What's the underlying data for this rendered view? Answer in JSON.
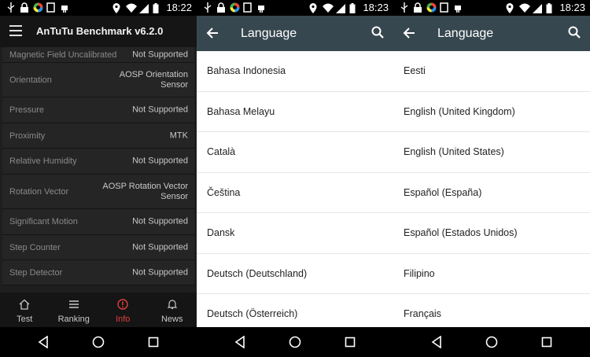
{
  "status": {
    "times": [
      "18:22",
      "18:23",
      "18:23"
    ]
  },
  "antutu": {
    "title": "AnTuTu Benchmark v6.2.0",
    "sensors": [
      {
        "name": "Magnetic Field Uncalibrated",
        "value": "Not Supported"
      },
      {
        "name": "Orientation",
        "value": "AOSP Orientation\nSensor"
      },
      {
        "name": "Pressure",
        "value": "Not Supported"
      },
      {
        "name": "Proximity",
        "value": "MTK"
      },
      {
        "name": "Relative Humidity",
        "value": "Not Supported"
      },
      {
        "name": "Rotation Vector",
        "value": "AOSP Rotation Vector\nSensor"
      },
      {
        "name": "Significant Motion",
        "value": "Not Supported"
      },
      {
        "name": "Step Counter",
        "value": "Not Supported"
      },
      {
        "name": "Step Detector",
        "value": "Not Supported"
      }
    ],
    "nav": [
      {
        "label": "Test",
        "icon": "home-icon",
        "active": false
      },
      {
        "label": "Ranking",
        "icon": "list-icon",
        "active": false
      },
      {
        "label": "Info",
        "icon": "info-icon",
        "active": true
      },
      {
        "label": "News",
        "icon": "bell-icon",
        "active": false
      }
    ]
  },
  "language_screen_1": {
    "title": "Language",
    "items": [
      "Bahasa Indonesia",
      "Bahasa Melayu",
      "Català",
      "Čeština",
      "Dansk",
      "Deutsch (Deutschland)",
      "Deutsch (Österreich)"
    ]
  },
  "language_screen_2": {
    "title": "Language",
    "items": [
      "Eesti",
      "English (United Kingdom)",
      "English (United States)",
      "Español (España)",
      "Español (Estados Unidos)",
      "Filipino",
      "Français"
    ]
  },
  "colors": {
    "antutu_bg": "#1e1e1e",
    "active_tab": "#e0403c",
    "toolbar": "#37474f"
  }
}
